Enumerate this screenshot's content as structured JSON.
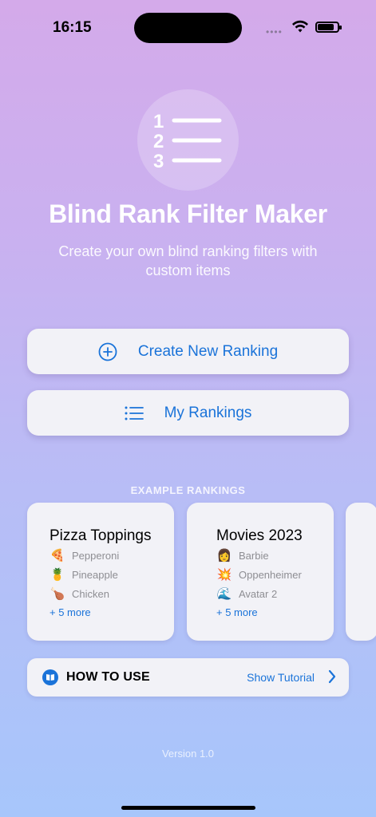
{
  "status_bar": {
    "time": "16:15"
  },
  "app": {
    "title": "Blind Rank Filter Maker",
    "subtitle": "Create your own blind ranking filters with custom items",
    "logo_numbers": [
      "1",
      "2",
      "3"
    ]
  },
  "actions": {
    "create_label": "Create New Ranking",
    "my_rankings_label": "My Rankings"
  },
  "examples": {
    "section_label": "EXAMPLE RANKINGS",
    "cards": [
      {
        "title": "Pizza Toppings",
        "items": [
          {
            "emoji": "🍕",
            "label": "Pepperoni"
          },
          {
            "emoji": "🍍",
            "label": "Pineapple"
          },
          {
            "emoji": "🍗",
            "label": "Chicken"
          }
        ],
        "more": "+ 5 more"
      },
      {
        "title": "Movies 2023",
        "items": [
          {
            "emoji": "👩",
            "label": "Barbie"
          },
          {
            "emoji": "💥",
            "label": "Oppenheimer"
          },
          {
            "emoji": "🌊",
            "label": "Avatar 2"
          }
        ],
        "more": "+ 5 more"
      }
    ]
  },
  "how_to": {
    "label": "HOW TO USE",
    "link": "Show Tutorial"
  },
  "footer": {
    "version": "Version 1.0"
  },
  "colors": {
    "accent": "#1a73d9",
    "card_bg": "#f2f2f7"
  }
}
